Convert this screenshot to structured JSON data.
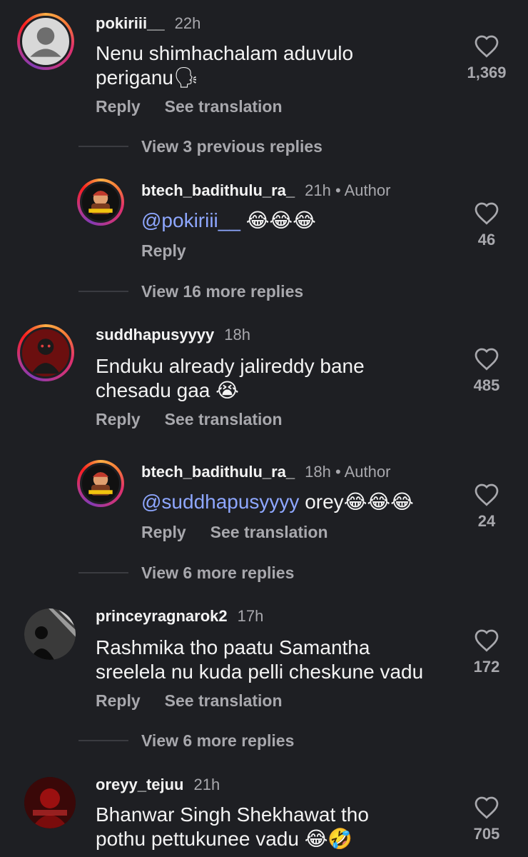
{
  "labels": {
    "reply": "Reply",
    "see_translation": "See translation",
    "author": "Author"
  },
  "emoji": {
    "speaking_head": "🗣",
    "joy3": "😂😂😂",
    "crying": "😭",
    "joy_rofl": "😂🤣"
  },
  "comments": [
    {
      "username": "pokiriii__",
      "time": "22h",
      "text_line1": "Nenu shimhachalam aduvulo",
      "text_line2": "periganu",
      "likes": "1,369"
    },
    {
      "view_replies": "View 3 previous replies"
    },
    {
      "username": "btech_badithulu_ra_",
      "time": "21h",
      "mention": "@pokiriii__",
      "likes": "46"
    },
    {
      "view_replies": "View 16 more replies"
    },
    {
      "username": "suddhapusyyyy",
      "time": "18h",
      "text_line1": "Enduku already jalireddy bane",
      "text_line2": "chesadu gaa",
      "likes": "485"
    },
    {
      "username": "btech_badithulu_ra_",
      "time": "18h",
      "mention": "@suddhapusyyyy",
      "text_after": " orey",
      "likes": "24"
    },
    {
      "view_replies": "View 6 more replies"
    },
    {
      "username": "princeyragnarok2",
      "time": "17h",
      "text_line1": "Rashmika tho paatu Samantha",
      "text_line2": "sreelela nu kuda pelli cheskune vadu",
      "likes": "172"
    },
    {
      "view_replies": "View 6 more replies"
    },
    {
      "username": "oreyy_tejuu",
      "time": "21h",
      "text_line1": "Bhanwar Singh Shekhawat tho",
      "text_line2": "pothu pettukunee vadu ",
      "likes": "705"
    }
  ],
  "colors": {
    "background": "#1e1f23",
    "text": "#f3f3f3",
    "muted": "#a8a8ad",
    "mention": "#8ea7ff"
  }
}
